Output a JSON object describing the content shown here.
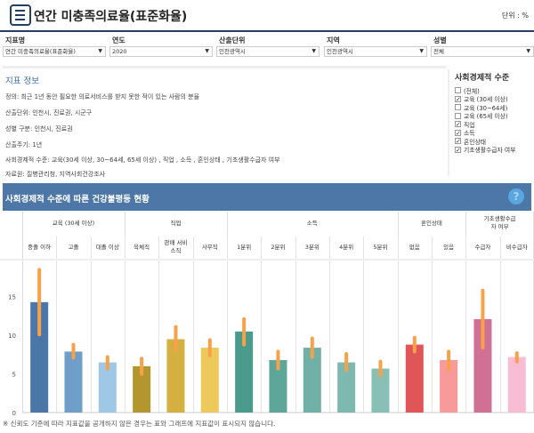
{
  "header": {
    "title": "연간 미충족의료율(표준화율)",
    "unit": "단위 : %"
  },
  "filters": [
    {
      "label": "지표명",
      "value": "연간 미충족의료율(표준화율)"
    },
    {
      "label": "연도",
      "value": "2020"
    },
    {
      "label": "산출단위",
      "value": "인천광역시"
    },
    {
      "label": "지역",
      "value": "인천광역시"
    },
    {
      "label": "성별",
      "value": "전체"
    }
  ],
  "info": {
    "title": "지표 정보",
    "lines": [
      "정의: 최근 1년 동안 필요한 의료서비스를 받지 못한 적이 있는 사람의 분율",
      "산출단위: 인천시, 진료권, 시군구",
      "성별 구분: 인천시, 진료권",
      "산출주기: 1년",
      "사회경제적 수준: 교육(30세 이상, 30~64세, 65세 이상) , 직업 , 소득 , 혼인상태 , 기초생활수급자 여부",
      "자료원: 질병관리청, 지역사회건강조사"
    ]
  },
  "ses": {
    "title": "사회경제적 수준",
    "items": [
      {
        "label": "(전체)",
        "checked": false
      },
      {
        "label": "교육 (30세 이상)",
        "checked": true
      },
      {
        "label": "교육 (30~64세)",
        "checked": false
      },
      {
        "label": "교육 (65세 이상)",
        "checked": false
      },
      {
        "label": "직업",
        "checked": true
      },
      {
        "label": "소득",
        "checked": true
      },
      {
        "label": "혼인상태",
        "checked": true
      },
      {
        "label": "기초생활수급자 여부",
        "checked": true
      }
    ]
  },
  "section": {
    "title": "사회경제적 수준에 따른 건강불평등 현황",
    "help": "?"
  },
  "footnote": "※ 신뢰도 기준에 따라 지표값을 공개하지 않은 경우는 표와 그래프에 지표값이 표시되지 않습니다.",
  "chart_data": {
    "type": "bar",
    "ylim": [
      0,
      19
    ],
    "yticks": [
      "0",
      "5",
      "10",
      "15"
    ],
    "error_color": "#f7a14a",
    "groups": [
      {
        "name": "교육 (30세 이상)",
        "span": 3
      },
      {
        "name": "직업",
        "span": 3
      },
      {
        "name": "소득",
        "span": 5
      },
      {
        "name": "혼인상태",
        "span": 2
      },
      {
        "name": "기초생활수급자 여부",
        "span": 2
      }
    ],
    "categories": [
      "중졸 이하",
      "고졸",
      "대졸 이상",
      "육체직",
      "판매 서비스직",
      "사무직",
      "1분위",
      "2분위",
      "3분위",
      "4분위",
      "5분위",
      "없음",
      "있음",
      "수급자",
      "비수급자"
    ],
    "values": [
      14.3,
      7.9,
      6.5,
      6.0,
      9.5,
      8.4,
      10.5,
      6.8,
      8.4,
      6.5,
      5.7,
      8.8,
      6.8,
      12.1,
      7.2
    ],
    "ci_low": [
      10.1,
      7.1,
      5.7,
      5.0,
      8.1,
      7.4,
      8.8,
      5.7,
      7.2,
      5.5,
      4.8,
      7.9,
      5.6,
      8.4,
      6.6
    ],
    "ci_high": [
      18.5,
      8.8,
      7.2,
      7.0,
      11.1,
      9.4,
      12.1,
      7.9,
      9.6,
      7.6,
      6.6,
      9.7,
      7.9,
      15.8,
      7.7
    ],
    "colors": [
      "#4a76a8",
      "#6f9fc8",
      "#9ec8e5",
      "#b4962e",
      "#d4b040",
      "#ecc95a",
      "#4a9a8e",
      "#5ea69a",
      "#70b0a6",
      "#7eb9b0",
      "#88c0b6",
      "#e05558",
      "#f99a9a",
      "#d07095",
      "#f8bdd2"
    ]
  }
}
